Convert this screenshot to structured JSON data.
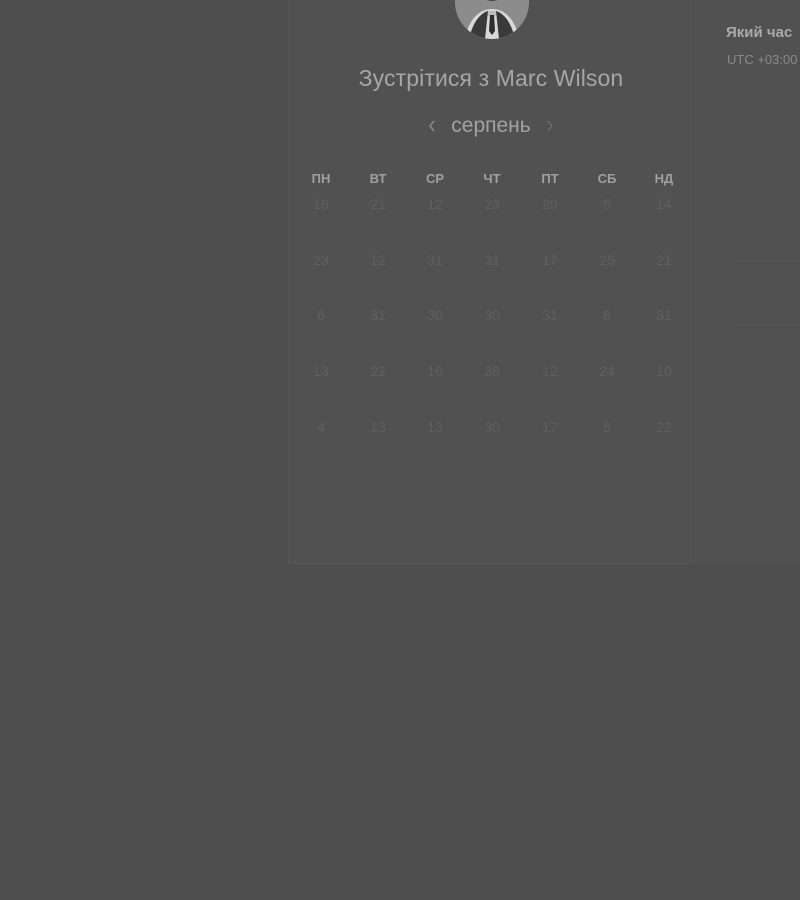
{
  "host": {
    "title": "Зустрітися з Marc Wilson",
    "avatar_icon": "person-avatar"
  },
  "calendar": {
    "month": "серпень",
    "prev_icon": "chevron-left-icon",
    "next_icon": "chevron-right-icon",
    "weekdays": [
      "ПН",
      "ВТ",
      "СР",
      "ЧТ",
      "ПТ",
      "СБ",
      "НД"
    ],
    "weeks": [
      [
        "16",
        "21",
        "12",
        "23",
        "29",
        "5",
        "14"
      ],
      [
        "23",
        "12",
        "31",
        "31",
        "17",
        "25",
        "21"
      ],
      [
        "6",
        "31",
        "30",
        "30",
        "31",
        "8",
        "31"
      ],
      [
        "13",
        "22",
        "16",
        "28",
        "12",
        "24",
        "10"
      ],
      [
        "4",
        "13",
        "13",
        "30",
        "17",
        "5",
        "22"
      ]
    ]
  },
  "time_panel": {
    "question": "Який час",
    "timezone": "UTC +03:00"
  },
  "colors": {
    "background": "#4e4e4e",
    "card": "#515151",
    "text_primary": "#a6a6a6",
    "text_muted": "#5f5f5f"
  }
}
